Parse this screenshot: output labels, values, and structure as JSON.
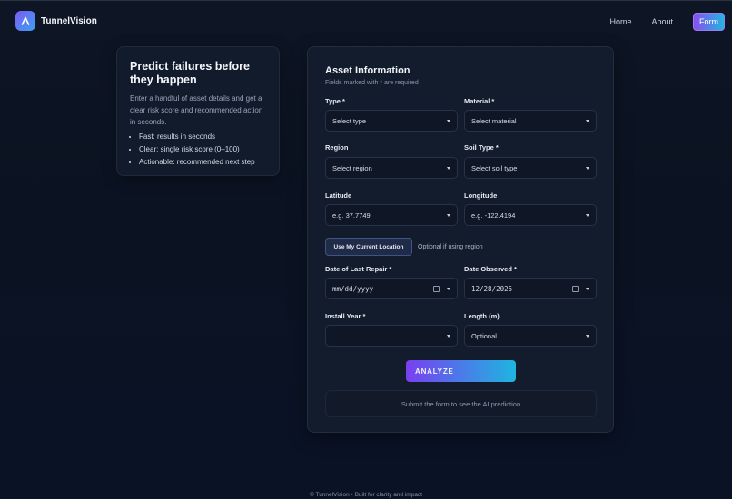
{
  "header": {
    "brand": "TunnelVision",
    "nav": {
      "home": "Home",
      "about": "About",
      "form": "Form"
    }
  },
  "info": {
    "title": "Predict failures before they happen",
    "description": "Enter a handful of asset details and get a clear risk score and recommended action in seconds.",
    "bullets": [
      "Fast: results in seconds",
      "Clear: single risk score (0–100)",
      "Actionable: recommended next step"
    ]
  },
  "form": {
    "title": "Asset Information",
    "subtitle": "Fields marked with * are required",
    "fields": {
      "type": {
        "label": "Type *",
        "value": "Select type"
      },
      "material": {
        "label": "Material *",
        "value": "Select material"
      },
      "region": {
        "label": "Region",
        "value": "Select region"
      },
      "soil": {
        "label": "Soil Type *",
        "value": "Select soil type"
      },
      "latitude": {
        "label": "Latitude",
        "placeholder": "e.g. 37.7749"
      },
      "longitude": {
        "label": "Longitude",
        "placeholder": "e.g. -122.4194"
      },
      "last_repair": {
        "label": "Date of Last Repair *",
        "value": "mm/dd/yyyy"
      },
      "observed": {
        "label": "Date Observed *",
        "value": "12/28/2025"
      },
      "install_year": {
        "label": "Install Year *",
        "value": ""
      },
      "length": {
        "label": "Length (m)",
        "value": "Optional"
      }
    },
    "location_button": "Use My Current Location",
    "location_hint": "Optional if using region",
    "analyze_button": "ANALYZE",
    "result_text": "Submit the form to see the AI prediction"
  },
  "footer": "© TunnelVision • Built for clarity and impact",
  "colors": {
    "accent_start": "#7a3ff0",
    "accent_end": "#1fb5e0",
    "background": "#0b1322"
  }
}
